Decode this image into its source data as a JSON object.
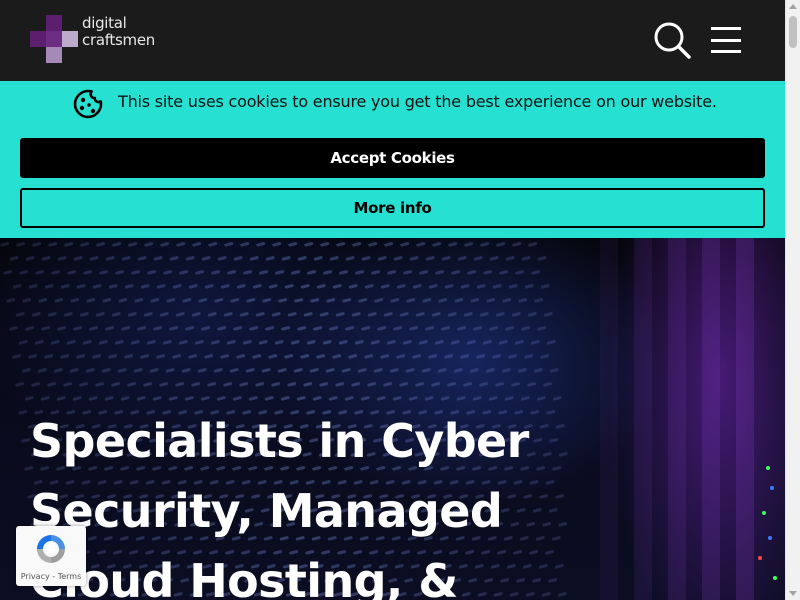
{
  "header": {
    "logo_line1": "digital",
    "logo_line2": "craftsmen",
    "search_icon": "search-icon",
    "menu_icon": "hamburger-menu-icon"
  },
  "cookie_banner": {
    "icon": "cookie-icon",
    "message": "This site uses cookies to ensure you get the best experience on our website.",
    "accept_label": "Accept Cookies",
    "more_info_label": "More info",
    "background_color": "#26e0d1"
  },
  "hero": {
    "title": "Specialists in Cyber Security, Managed Cloud Hosting, &"
  },
  "recaptcha": {
    "privacy_label": "Privacy",
    "separator": " - ",
    "terms_label": "Terms"
  },
  "colors": {
    "header_bg": "#1b1b1b",
    "logo_purple_dark": "#5b1f6e",
    "logo_purple_light": "#a58ab8",
    "accent_teal": "#26e0d1"
  }
}
